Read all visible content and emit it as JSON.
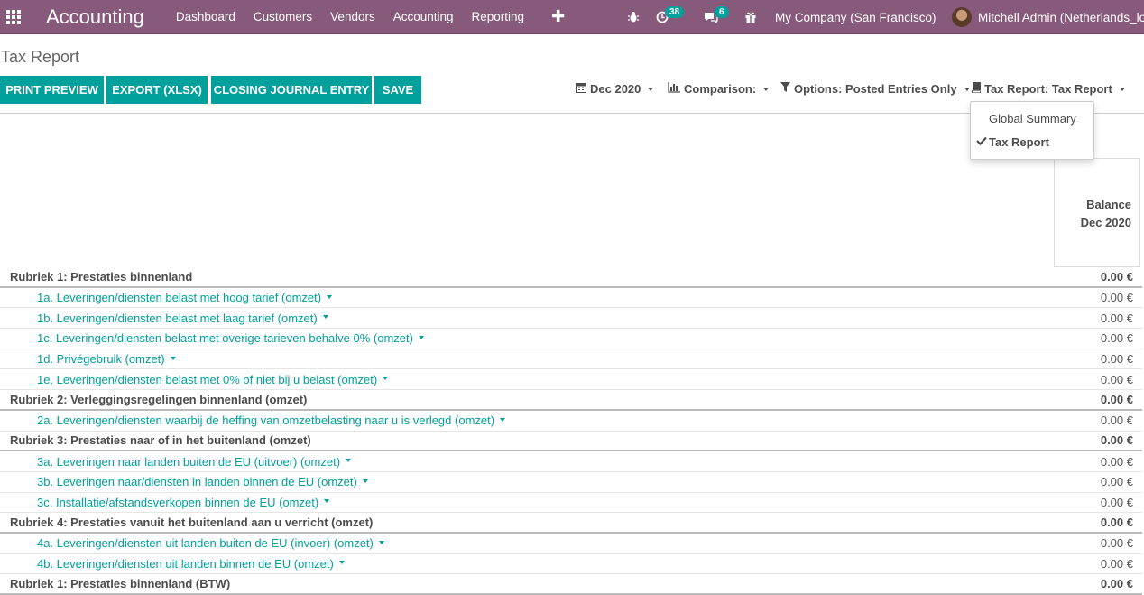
{
  "navbar": {
    "app_title": "Accounting",
    "menu": [
      "Dashboard",
      "Customers",
      "Vendors",
      "Accounting",
      "Reporting"
    ],
    "plus": "✚",
    "activity_count": "38",
    "messages_count": "6",
    "company": "My Company (San Francisco)",
    "user": "Mitchell Admin (Netherlands_loc"
  },
  "page": {
    "title": "Tax Report",
    "buttons": [
      "PRINT PREVIEW",
      "EXPORT (XLSX)",
      "CLOSING JOURNAL ENTRY",
      "SAVE"
    ],
    "filters": {
      "date": "Dec 2020",
      "comparison": "Comparison:",
      "options": "Options: Posted Entries Only",
      "report": "Tax Report: Tax Report"
    },
    "dropdown": [
      "Global Summary",
      "Tax Report"
    ],
    "column_header": [
      "Balance",
      "Dec 2020"
    ]
  },
  "report": {
    "rows": [
      {
        "type": "section",
        "label": "Rubriek 1: Prestaties binnenland",
        "value": "0.00 €"
      },
      {
        "type": "line",
        "label": "1a. Leveringen/diensten belast met hoog tarief (omzet)",
        "value": "0.00 €"
      },
      {
        "type": "line",
        "label": "1b. Leveringen/diensten belast met laag tarief (omzet)",
        "value": "0.00 €"
      },
      {
        "type": "line",
        "label": "1c. Leveringen/diensten belast met overige tarieven behalve 0% (omzet)",
        "value": "0.00 €"
      },
      {
        "type": "line",
        "label": "1d. Privégebruik (omzet)",
        "value": "0.00 €"
      },
      {
        "type": "line",
        "label": "1e. Leveringen/diensten belast met 0% of niet bij u belast (omzet)",
        "value": "0.00 €"
      },
      {
        "type": "section",
        "label": "Rubriek 2: Verleggingsregelingen binnenland (omzet)",
        "value": "0.00 €"
      },
      {
        "type": "line",
        "label": "2a. Leveringen/diensten waarbij de heffing van omzetbelasting naar u is verlegd (omzet)",
        "value": "0.00 €"
      },
      {
        "type": "section",
        "label": "Rubriek 3: Prestaties naar of in het buitenland (omzet)",
        "value": "0.00 €"
      },
      {
        "type": "line",
        "label": "3a. Leveringen naar landen buiten de EU (uitvoer) (omzet)",
        "value": "0.00 €"
      },
      {
        "type": "line",
        "label": "3b. Leveringen naar/diensten in landen binnen de EU (omzet)",
        "value": "0.00 €"
      },
      {
        "type": "line",
        "label": "3c. Installatie/afstandsverkopen binnen de EU (omzet)",
        "value": "0.00 €"
      },
      {
        "type": "section",
        "label": "Rubriek 4: Prestaties vanuit het buitenland aan u verricht (omzet)",
        "value": "0.00 €"
      },
      {
        "type": "line",
        "label": "4a. Leveringen/diensten uit landen buiten de EU (invoer) (omzet)",
        "value": "0.00 €"
      },
      {
        "type": "line",
        "label": "4b. Leveringen/diensten uit landen binnen de EU (omzet)",
        "value": "0.00 €"
      },
      {
        "type": "section",
        "label": "Rubriek 1: Prestaties binnenland (BTW)",
        "value": "0.00 €"
      }
    ]
  }
}
